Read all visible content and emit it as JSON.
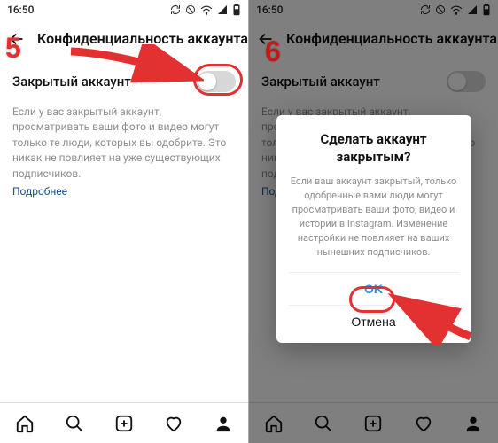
{
  "colors": {
    "accent": "#e33131",
    "link": "#1a4b8c",
    "dialog_ok": "#2f90e6"
  },
  "status": {
    "time": "16:50",
    "icons": [
      "sync-icon",
      "mute-icon",
      "wifi-icon",
      "signal-icon",
      "battery-icon"
    ]
  },
  "header": {
    "back_icon": "arrow-left-icon",
    "title": "Конфиденциальность аккаунта"
  },
  "privacy": {
    "toggle_label": "Закрытый аккаунт",
    "toggle_state": "off",
    "description": "Если у вас закрытый аккаунт, просматривать ваши фото и видео могут только те люди, которых вы одобрите. Это никак не повлияет на уже существующих подписчиков.",
    "more_label": "Подробнее"
  },
  "nav": {
    "items": [
      "home-icon",
      "search-icon",
      "add-icon",
      "heart-icon",
      "profile-icon"
    ]
  },
  "dialog": {
    "title": "Сделать аккаунт закрытым?",
    "body": "Если ваш аккаунт закрытый, только одобренные вами люди могут просматривать ваши фото, видео и истории в Instagram. Изменение настройки не повлияет на ваших нынешних подписчиков.",
    "ok_label": "OK",
    "cancel_label": "Отмена"
  },
  "annotations": {
    "step5": "5",
    "step6": "6"
  }
}
